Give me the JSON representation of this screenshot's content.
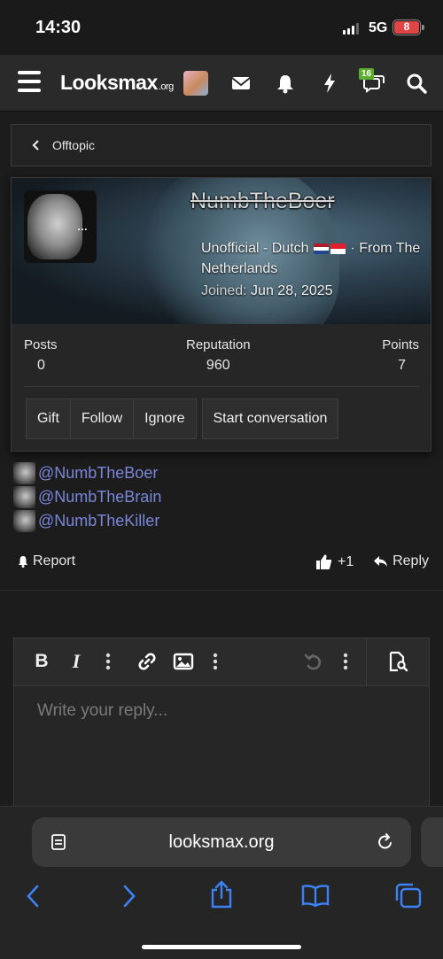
{
  "status": {
    "time": "14:30",
    "network": "5G",
    "battery": "8"
  },
  "nav": {
    "logo_main": "Looksmax",
    "logo_suffix": ".org",
    "chat_badge": "16"
  },
  "breadcrumb": {
    "label": "Offtopic"
  },
  "profile": {
    "username": "NumbTheBoer",
    "title_pre": "Unofficial - Dutch",
    "title_post": "· From The Netherlands",
    "joined_label": "Joined:",
    "joined_date": "Jun 28, 2025",
    "stats": [
      {
        "label": "Posts",
        "value": "0"
      },
      {
        "label": "Reputation",
        "value": "960"
      },
      {
        "label": "Points",
        "value": "7"
      }
    ],
    "actions": {
      "gift": "Gift",
      "follow": "Follow",
      "ignore": "Ignore",
      "start": "Start conversation"
    }
  },
  "mentions": [
    "@NumbTheBoer",
    "@NumbTheBrain",
    "@NumbTheKiller"
  ],
  "post_footer": {
    "report": "Report",
    "like": "+1",
    "reply": "Reply"
  },
  "editor": {
    "placeholder": "Write your reply..."
  },
  "safari": {
    "url": "looksmax.org"
  },
  "colors": {
    "mention": "#7a86d8",
    "badge": "#5aad2d",
    "battery": "#e04545",
    "safari_blue": "#3b82f6"
  }
}
